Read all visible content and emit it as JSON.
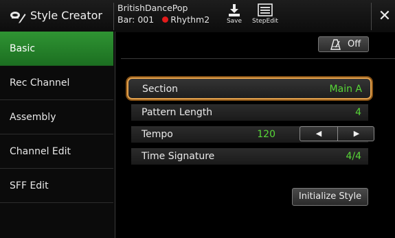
{
  "header": {
    "app_title": "Style Creator",
    "style_name": "BritishDancePop",
    "bar_label": "Bar: 001",
    "record_part": "Rhythm2",
    "save_label": "Save",
    "stepedit_label": "StepEdit",
    "close_glyph": "✕",
    "icons": [
      "style-creator-icon",
      "save-icon",
      "stepedit-icon",
      "close-icon"
    ]
  },
  "sidebar": {
    "items": [
      {
        "label": "Basic",
        "active": true
      },
      {
        "label": "Rec Channel",
        "active": false
      },
      {
        "label": "Assembly",
        "active": false
      },
      {
        "label": "Channel Edit",
        "active": false
      },
      {
        "label": "SFF Edit",
        "active": false
      }
    ]
  },
  "main": {
    "metronome_button": {
      "label": "Off",
      "icon": "metronome-icon"
    },
    "rows": [
      {
        "label": "Section",
        "value": "Main A"
      },
      {
        "label": "Pattern Length",
        "value": "4"
      },
      {
        "label": "Tempo",
        "value": "120",
        "dec_glyph": "◀",
        "inc_glyph": "▶"
      },
      {
        "label": "Time Signature",
        "value": "4/4"
      }
    ],
    "initialize_button": "Initialize Style"
  },
  "colors": {
    "active_tab": "#2a8a2e",
    "value_green": "#58d838",
    "selection_orange": "#e5a34e",
    "record_red": "#e21b1b"
  }
}
